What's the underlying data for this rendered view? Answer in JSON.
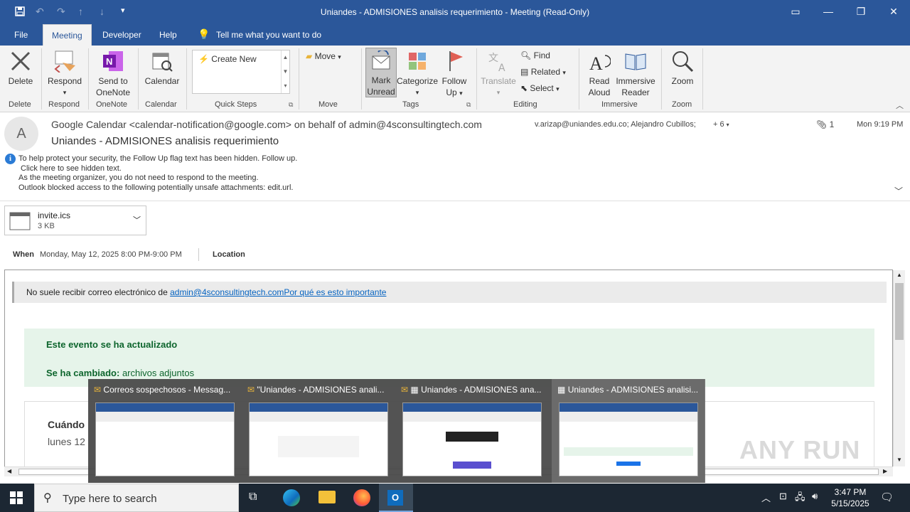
{
  "window": {
    "title": "Uniandes - ADMISIONES analisis requerimiento  -  Meeting  (Read-Only)"
  },
  "menu": {
    "tabs": [
      "File",
      "Meeting",
      "Developer",
      "Help"
    ],
    "tell_me": "Tell me what you want to do"
  },
  "ribbon": {
    "delete": "Delete",
    "respond": "Respond",
    "send_onenote_1": "Send to",
    "send_onenote_2": "OneNote",
    "calendar": "Calendar",
    "quick_steps_create": "Create New",
    "move": "Move",
    "mark_unread_1": "Mark",
    "mark_unread_2": "Unread",
    "categorize": "Categorize",
    "follow_up_1": "Follow",
    "follow_up_2": "Up",
    "translate": "Translate",
    "find": "Find",
    "related": "Related",
    "select": "Select",
    "read_aloud_1": "Read",
    "read_aloud_2": "Aloud",
    "immersive_1": "Immersive",
    "immersive_2": "Reader",
    "zoom": "Zoom",
    "groups": {
      "delete": "Delete",
      "respond": "Respond",
      "onenote": "OneNote",
      "calendar": "Calendar",
      "quick_steps": "Quick Steps",
      "move": "Move",
      "tags": "Tags",
      "editing": "Editing",
      "immersive": "Immersive",
      "zoom": "Zoom"
    }
  },
  "message": {
    "avatar_letter": "A",
    "from": "Google Calendar <calendar-notification@google.com> on behalf of admin@4sconsultingtech.com",
    "to": "v.arizap@uniandes.edu.co; Alejandro Cubillos;",
    "more_recipients": "+ 6",
    "attachment_count": "1",
    "time": "Mon 9:19 PM",
    "subject": "Uniandes - ADMISIONES analisis requerimiento",
    "info_lines": [
      "To help protect your security, the Follow Up flag text has been hidden. Follow up.",
      "Click here to see hidden text.",
      "As the meeting organizer, you do not need to respond to the meeting.",
      "Outlook blocked access to the following potentially unsafe attachments: edit.url."
    ],
    "attachment_name": "invite.ics",
    "attachment_size": "3 KB",
    "when_label": "When",
    "when_value": "Monday, May 12, 2025 8:00 PM-9:00 PM",
    "location_label": "Location"
  },
  "body": {
    "warning_prefix": "No suele recibir correo electrónico de",
    "warning_email": "admin@4sconsultingtech.com",
    "warning_link": "Por qué es esto importante",
    "event_updated": "Este evento se ha actualizado",
    "changed_label": "Se ha cambiado:",
    "changed_value": "archivos adjuntos",
    "cuando": "Cuándo",
    "cuando_value": "lunes 12"
  },
  "thumbnails": [
    {
      "title": "Correos sospechosos - Messag..."
    },
    {
      "title": "\"Uniandes - ADMISIONES anali..."
    },
    {
      "title": "Uniandes - ADMISIONES ana..."
    },
    {
      "title": "Uniandes - ADMISIONES analisi..."
    }
  ],
  "taskbar": {
    "search_placeholder": "Type here to search",
    "time": "3:47 PM",
    "date": "5/15/2025"
  },
  "watermark": "ANY RUN",
  "colors": {
    "titlebar": "#2b579a",
    "taskbar": "#1c2733",
    "event_box": "#e6f4ea",
    "event_text": "#0d652d"
  }
}
